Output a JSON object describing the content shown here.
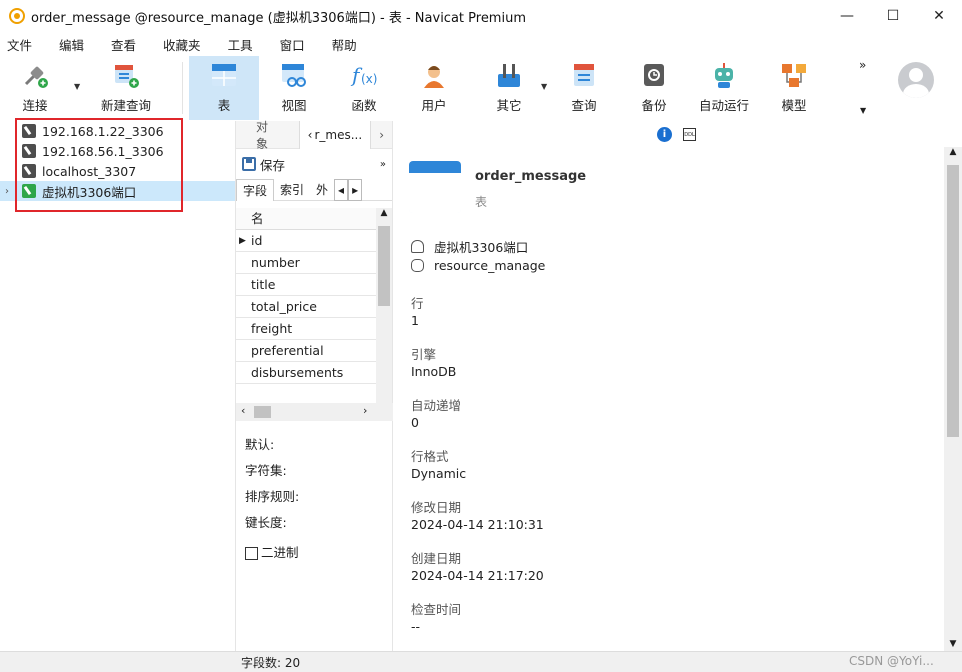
{
  "window": {
    "title": "order_message @resource_manage (虚拟机3306端口) - 表 - Navicat Premium",
    "controls": [
      "—",
      "☐",
      "✕"
    ]
  },
  "menu": [
    "文件",
    "编辑",
    "查看",
    "收藏夹",
    "工具",
    "窗口",
    "帮助"
  ],
  "toolbar": {
    "connect": "连接",
    "new_query": "新建查询",
    "table": "表",
    "view": "视图",
    "function": "函数",
    "user": "用户",
    "other": "其它",
    "query": "查询",
    "backup": "备份",
    "auto_run": "自动运行",
    "model": "模型",
    "more": "»"
  },
  "connections": [
    {
      "label": "192.168.1.22_3306"
    },
    {
      "label": "192.168.56.1_3306"
    },
    {
      "label": "localhost_3307"
    },
    {
      "label": "虚拟机3306端口"
    }
  ],
  "mid": {
    "tabs": [
      "对象",
      "r_mes..."
    ],
    "save": "保存",
    "sub_tabs": [
      "字段",
      "索引",
      "外"
    ],
    "grid_header": "名",
    "fields": [
      "id",
      "number",
      "title",
      "total_price",
      "freight",
      "preferential",
      "disbursements"
    ],
    "props": {
      "default": "默认:",
      "charset": "字符集:",
      "collation": "排序规则:",
      "key_length": "键长度:",
      "binary": "二进制"
    }
  },
  "object": {
    "name": "order_message",
    "type": "表",
    "connection": "虚拟机3306端口",
    "database": "resource_manage",
    "props": [
      {
        "label": "行",
        "value": "1"
      },
      {
        "label": "引擎",
        "value": "InnoDB"
      },
      {
        "label": "自动递增",
        "value": "0"
      },
      {
        "label": "行格式",
        "value": "Dynamic"
      },
      {
        "label": "修改日期",
        "value": "2024-04-14 21:10:31"
      },
      {
        "label": "创建日期",
        "value": "2024-04-14 21:17:20"
      },
      {
        "label": "检查时间",
        "value": "--"
      }
    ]
  },
  "status": {
    "field_count": "字段数: 20",
    "watermark": "CSDN @YoYi..."
  },
  "colors": {
    "accent": "#cfe6f8",
    "selection": "#cce8fb",
    "highlight_box": "#e0262b"
  }
}
